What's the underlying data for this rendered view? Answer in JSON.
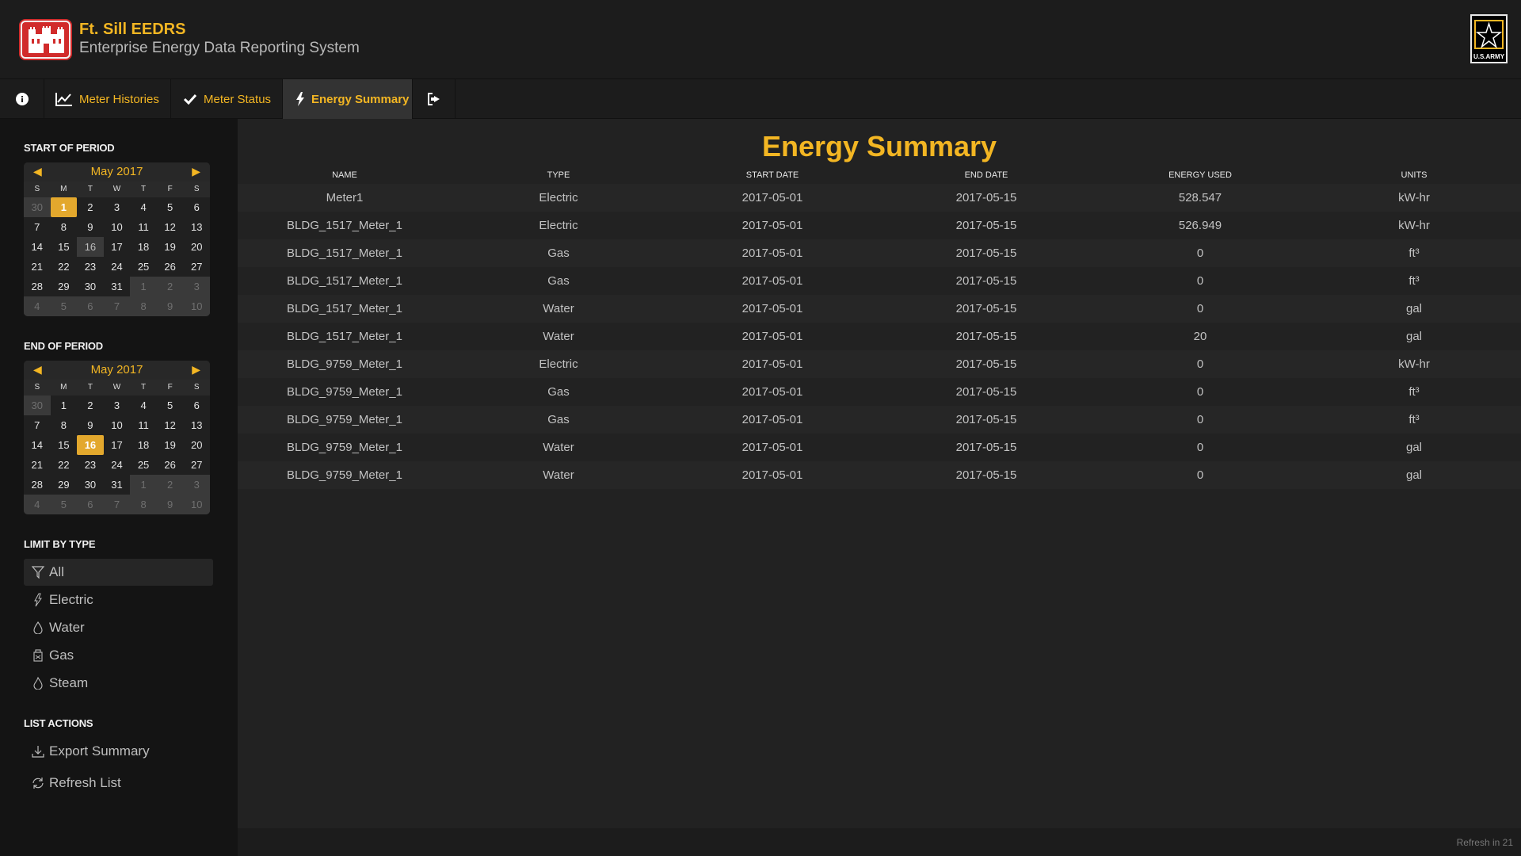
{
  "header": {
    "title": "Ft. Sill EEDRS",
    "subtitle": "Enterprise Energy Data Reporting System",
    "army_label": "U.S.ARMY"
  },
  "nav": {
    "info_icon": "info-icon",
    "items": [
      {
        "label": "Meter Histories",
        "icon": "chart-line-icon"
      },
      {
        "label": "Meter Status",
        "icon": "check-icon"
      },
      {
        "label": "Energy Summary",
        "icon": "bolt-icon"
      }
    ],
    "logout_icon": "sign-out-icon"
  },
  "sidebar": {
    "start_label": "START OF PERIOD",
    "end_label": "END OF PERIOD",
    "start_calendar": {
      "month": "May 2017",
      "dow": [
        "S",
        "M",
        "T",
        "W",
        "T",
        "F",
        "S"
      ],
      "selected": "1",
      "today": "16",
      "weeks": [
        [
          "30",
          "1",
          "2",
          "3",
          "4",
          "5",
          "6"
        ],
        [
          "7",
          "8",
          "9",
          "10",
          "11",
          "12",
          "13"
        ],
        [
          "14",
          "15",
          "16",
          "17",
          "18",
          "19",
          "20"
        ],
        [
          "21",
          "22",
          "23",
          "24",
          "25",
          "26",
          "27"
        ],
        [
          "28",
          "29",
          "30",
          "31",
          "1",
          "2",
          "3"
        ],
        [
          "4",
          "5",
          "6",
          "7",
          "8",
          "9",
          "10"
        ]
      ]
    },
    "end_calendar": {
      "month": "May 2017",
      "dow": [
        "S",
        "M",
        "T",
        "W",
        "T",
        "F",
        "S"
      ],
      "selected": "16",
      "weeks": [
        [
          "30",
          "1",
          "2",
          "3",
          "4",
          "5",
          "6"
        ],
        [
          "7",
          "8",
          "9",
          "10",
          "11",
          "12",
          "13"
        ],
        [
          "14",
          "15",
          "16",
          "17",
          "18",
          "19",
          "20"
        ],
        [
          "21",
          "22",
          "23",
          "24",
          "25",
          "26",
          "27"
        ],
        [
          "28",
          "29",
          "30",
          "31",
          "1",
          "2",
          "3"
        ],
        [
          "4",
          "5",
          "6",
          "7",
          "8",
          "9",
          "10"
        ]
      ]
    },
    "limit_label": "LIMIT BY TYPE",
    "filters": [
      {
        "label": "All",
        "icon": "filter-icon"
      },
      {
        "label": "Electric",
        "icon": "bolt-icon"
      },
      {
        "label": "Water",
        "icon": "droplet-icon"
      },
      {
        "label": "Gas",
        "icon": "gas-can-icon"
      },
      {
        "label": "Steam",
        "icon": "flame-icon"
      }
    ],
    "actions_label": "LIST ACTIONS",
    "actions": [
      {
        "label": "Export Summary",
        "icon": "download-icon"
      },
      {
        "label": "Refresh List",
        "icon": "refresh-icon"
      }
    ]
  },
  "main": {
    "title": "Energy Summary",
    "columns": [
      "NAME",
      "TYPE",
      "START DATE",
      "END DATE",
      "ENERGY USED",
      "UNITS"
    ],
    "rows": [
      [
        "Meter1",
        "Electric",
        "2017-05-01",
        "2017-05-15",
        "528.547",
        "kW-hr"
      ],
      [
        "BLDG_1517_Meter_1",
        "Electric",
        "2017-05-01",
        "2017-05-15",
        "526.949",
        "kW-hr"
      ],
      [
        "BLDG_1517_Meter_1",
        "Gas",
        "2017-05-01",
        "2017-05-15",
        "0",
        "ft³"
      ],
      [
        "BLDG_1517_Meter_1",
        "Gas",
        "2017-05-01",
        "2017-05-15",
        "0",
        "ft³"
      ],
      [
        "BLDG_1517_Meter_1",
        "Water",
        "2017-05-01",
        "2017-05-15",
        "0",
        "gal"
      ],
      [
        "BLDG_1517_Meter_1",
        "Water",
        "2017-05-01",
        "2017-05-15",
        "20",
        "gal"
      ],
      [
        "BLDG_9759_Meter_1",
        "Electric",
        "2017-05-01",
        "2017-05-15",
        "0",
        "kW-hr"
      ],
      [
        "BLDG_9759_Meter_1",
        "Gas",
        "2017-05-01",
        "2017-05-15",
        "0",
        "ft³"
      ],
      [
        "BLDG_9759_Meter_1",
        "Gas",
        "2017-05-01",
        "2017-05-15",
        "0",
        "ft³"
      ],
      [
        "BLDG_9759_Meter_1",
        "Water",
        "2017-05-01",
        "2017-05-15",
        "0",
        "gal"
      ],
      [
        "BLDG_9759_Meter_1",
        "Water",
        "2017-05-01",
        "2017-05-15",
        "0",
        "gal"
      ]
    ]
  },
  "footer": {
    "refresh_text": "Refresh in 21"
  },
  "colors": {
    "accent": "#f3b623",
    "brand_red": "#d12b2b",
    "selected_day": "#e3a82d"
  }
}
